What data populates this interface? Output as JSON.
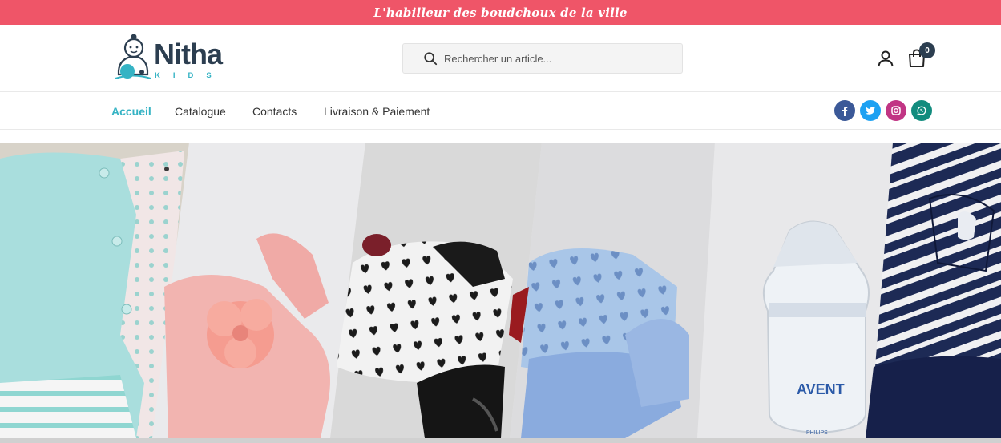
{
  "announcement": {
    "text": "L'habilleur des boudchoux de la ville",
    "bg_color": "#ef5568"
  },
  "logo": {
    "name": "Nitha",
    "subtitle": "KIDS",
    "icon": "baby-logo-icon"
  },
  "search": {
    "placeholder": "Rechercher un article...",
    "icon": "search-icon"
  },
  "header_actions": {
    "user_icon": "user-icon",
    "cart_icon": "shopping-bag-icon",
    "cart_count": "0"
  },
  "nav": {
    "items": [
      {
        "label": "Accueil",
        "active": true
      },
      {
        "label": "Catalogue",
        "active": false
      },
      {
        "label": "Contacts",
        "active": false
      },
      {
        "label": "Livraison & Paiement",
        "active": false
      }
    ],
    "accent_color": "#35b3c4"
  },
  "social": [
    {
      "name": "facebook-icon",
      "color": "#3b5998"
    },
    {
      "name": "twitter-icon",
      "color": "#1da1f2"
    },
    {
      "name": "instagram-icon",
      "color": "#c13584"
    },
    {
      "name": "whatsapp-icon",
      "color": "#128c7e"
    }
  ],
  "hero": {
    "panels": [
      "mint-cardigan-photo",
      "pink-flower-sandal-photo",
      "heart-print-patent-shoe-photo",
      "blue-heart-bootie-photo",
      "avent-bottle-photo",
      "striped-navy-dress-photo"
    ],
    "bottle_brand": "AVENT",
    "bottle_sub": "PHILIPS"
  }
}
